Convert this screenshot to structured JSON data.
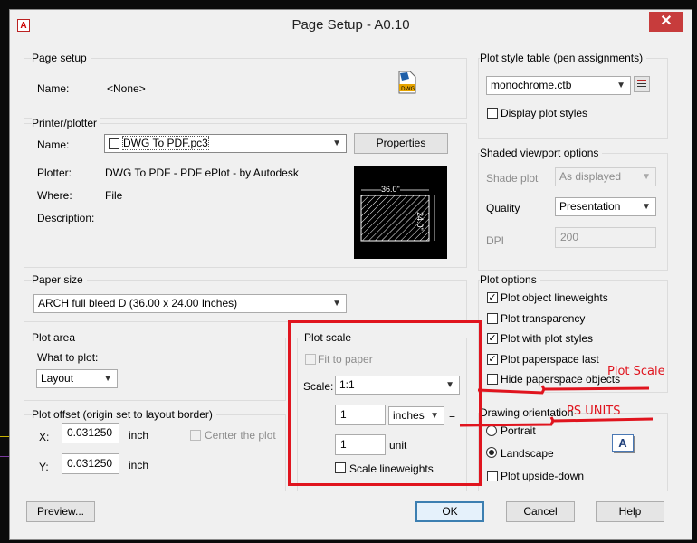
{
  "window": {
    "title": "Page Setup - A0.10",
    "close_glyph": "✕",
    "app_icon": "autocad-icon"
  },
  "page_setup": {
    "group_label": "Page setup",
    "name_label": "Name:",
    "name_value": "<None>",
    "icon": "dwg-file-icon"
  },
  "printer": {
    "group_label": "Printer/plotter",
    "name_label": "Name:",
    "name_value": "DWG To PDF.pc3",
    "properties_button": "Properties",
    "plotter_label": "Plotter:",
    "plotter_value": "DWG To PDF - PDF ePlot - by Autodesk",
    "where_label": "Where:",
    "where_value": "File",
    "description_label": "Description:",
    "preview_width": "36.0\"",
    "preview_height": "24.0\""
  },
  "paper_size": {
    "group_label": "Paper size",
    "value": "ARCH full bleed D (36.00 x 24.00 Inches)"
  },
  "plot_area": {
    "group_label": "Plot area",
    "what_label": "What to plot:",
    "what_value": "Layout"
  },
  "plot_offset": {
    "group_label": "Plot offset (origin set to layout border)",
    "x_label": "X:",
    "x_value": "0.031250",
    "x_unit": "inch",
    "y_label": "Y:",
    "y_value": "0.031250",
    "y_unit": "inch",
    "center_label": "Center the plot"
  },
  "plot_scale": {
    "group_label": "Plot scale",
    "fit_label": "Fit to paper",
    "scale_label": "Scale:",
    "scale_value": "1:1",
    "inches_value": "1",
    "inches_unit": "inches",
    "equals": "=",
    "unit_value": "1",
    "unit_label": "unit",
    "scale_lineweights_label": "Scale lineweights"
  },
  "plot_style_table": {
    "group_label": "Plot style table (pen assignments)",
    "value": "monochrome.ctb",
    "display_label": "Display plot styles"
  },
  "shaded_viewport": {
    "group_label": "Shaded viewport options",
    "shade_label": "Shade plot",
    "shade_value": "As displayed",
    "quality_label": "Quality",
    "quality_value": "Presentation",
    "dpi_label": "DPI",
    "dpi_value": "200"
  },
  "plot_options": {
    "group_label": "Plot options",
    "items": [
      {
        "label": "Plot object lineweights",
        "checked": true
      },
      {
        "label": "Plot transparency",
        "checked": false
      },
      {
        "label": "Plot with plot styles",
        "checked": true
      },
      {
        "label": "Plot paperspace last",
        "checked": true
      },
      {
        "label": "Hide paperspace objects",
        "checked": false
      }
    ]
  },
  "orientation": {
    "group_label": "Drawing orientation",
    "portrait": "Portrait",
    "landscape": "Landscape",
    "upside_down": "Plot upside-down"
  },
  "buttons": {
    "preview": "Preview...",
    "ok": "OK",
    "cancel": "Cancel",
    "help": "Help"
  },
  "annotations": {
    "plot_scale": "Plot Scale",
    "ps_units": "PS UNITS",
    "color": "#e0141e"
  }
}
